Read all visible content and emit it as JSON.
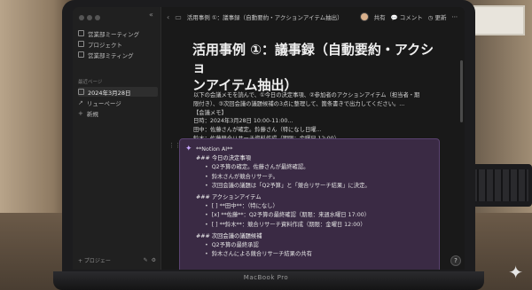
{
  "laptop_brand": "MacBook Pro",
  "sidebar": {
    "collapse_glyph": "«",
    "items_top": [
      {
        "label": "営業部ミーティング",
        "icon": "page-icon"
      },
      {
        "label": "プロジェクト",
        "icon": "page-icon"
      },
      {
        "label": "営業部ミティング",
        "icon": "page-icon"
      }
    ],
    "section_label": "最近ページ",
    "items_recent": [
      {
        "label": "2024年3月28日",
        "icon": "page-icon"
      },
      {
        "label": "リューページ",
        "icon": "sparkle-icon"
      },
      {
        "label": "新規",
        "icon": "plus-icon"
      }
    ],
    "bottom_label": "+ プロジェー"
  },
  "topbar": {
    "breadcrumb": "活用事例 ①：議事録（自動要約・アクションアイテム抽出）",
    "share": "共有",
    "comment": "コメント",
    "updates": "更新"
  },
  "page": {
    "title_line1": "活用事例 ①：議事録（自動要約・アクショ",
    "title_line2": "ンアイテム抽出）",
    "para": [
      "以下の会議メモを読んで、①今日の決定事項、②参加者のアクションアイテム（担当者・期",
      "限付き）、③次回会議の議題候補の3点に整理して、箇条書きで出力してください。...",
      "【会議メモ】",
      "日時：2024年3月28日 10:00-11:00...",
      "田中：佐藤さんが確定。鈴藤さん（特になし日曜...",
      "鈴木：佐藤競合リサーチ資料作成（期限：金曜日 12:00）..."
    ]
  },
  "ai_block": {
    "header": "**Notion AI**",
    "lines": [
      {
        "text": "### 今日の決定事項",
        "type": "h"
      },
      {
        "text": "Q2予算の確定。佐藤さんが最終確認。",
        "type": "b"
      },
      {
        "text": "鈴木さんが競合リサーチ。",
        "type": "b"
      },
      {
        "text": "次回会議の議題は「Q2予算」と「競合リサーチ結果」に決定。",
        "type": "b"
      },
      {
        "text": "### アクションアイテム",
        "type": "h"
      },
      {
        "text": "[ ] **田中**：（特になし）",
        "type": "b"
      },
      {
        "text": "[x] **佐藤**：Q2予算の最終確認（期限：来週水曜日 17:00）",
        "type": "b"
      },
      {
        "text": "[ ] **鈴木**：競合リサーチ資料作成（期限：金曜日 12:00）",
        "type": "b"
      },
      {
        "text": "### 次回会議の議題候補",
        "type": "h"
      },
      {
        "text": "Q2予算の最終承認",
        "type": "b"
      },
      {
        "text": "鈴木さんによる競合リサーチ結果の共有",
        "type": "b"
      }
    ]
  },
  "help_label": "?",
  "colors": {
    "ai_block_bg": "#3a2a44",
    "app_bg": "#191919",
    "sidebar_bg": "#202020"
  }
}
